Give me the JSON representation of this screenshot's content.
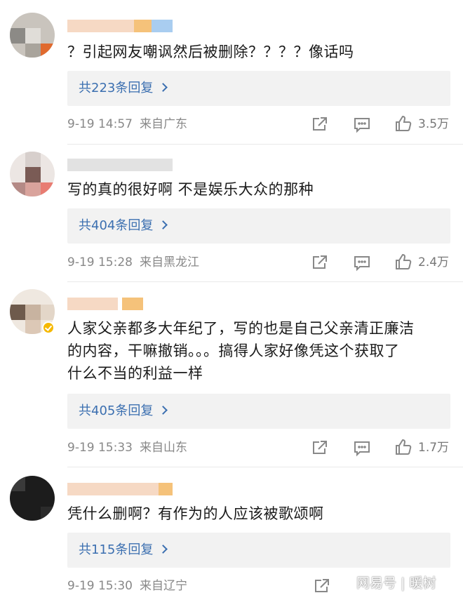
{
  "comments": [
    {
      "text": "？引起网友嘲讽然后被删除？？？？像话吗",
      "replies_label": "共223条回复",
      "time": "9-19 14:57",
      "location": "来自广东",
      "likes": "3.5万"
    },
    {
      "text": "写的真的很好啊 不是娱乐大众的那种",
      "replies_label": "共404条回复",
      "time": "9-19 15:28",
      "location": "来自黑龙江",
      "likes": "2.4万"
    },
    {
      "text_lines": [
        "人家父亲都多大年纪了，写的也是自己父亲清正廉洁",
        "的内容，干嘛撤销。。。搞得人家好像凭这个获取了",
        "什么不当的利益一样"
      ],
      "replies_label": "共405条回复",
      "time": "9-19 15:33",
      "location": "来自山东",
      "likes": "1.7万"
    },
    {
      "text": "凭什么删啊？有作为的人应该被歌颂啊",
      "replies_label": "共115条回复",
      "time": "9-19 15:30",
      "location": "来自辽宁",
      "likes": ""
    }
  ],
  "icons": {
    "share": "share-icon",
    "comment": "comment-icon",
    "like": "thumbs-up-icon",
    "chevron": "chevron-right-icon"
  },
  "colors": {
    "link": "#3b6fb0",
    "meta": "#888888",
    "reply_bg": "#f2f2f2",
    "verified": "#f5b800"
  },
  "watermark": "网易号 | 暖树"
}
